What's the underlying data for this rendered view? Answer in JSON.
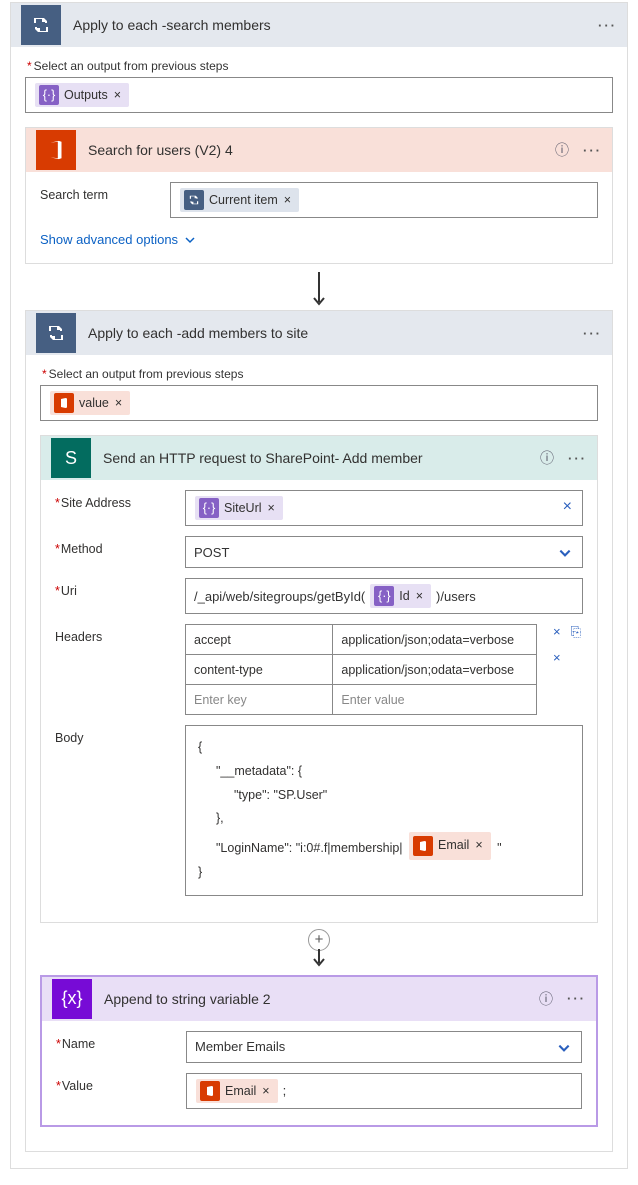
{
  "foreach1": {
    "title": "Apply to each -search members",
    "select_label": "Select an output from previous steps",
    "pill": "Outputs"
  },
  "o365search": {
    "title": "Search for users (V2) 4",
    "field_label": "Search term",
    "pill": "Current item",
    "advanced": "Show advanced options"
  },
  "foreach2": {
    "title": "Apply to each -add members to site",
    "select_label": "Select an output from previous steps",
    "pill": "value"
  },
  "sphttp": {
    "title": "Send an HTTP request to SharePoint- Add member",
    "fields": {
      "site_label": "Site Address",
      "site_pill": "SiteUrl",
      "method_label": "Method",
      "method_value": "POST",
      "uri_label": "Uri",
      "uri_prefix": "/_api/web/sitegroups/getById(",
      "uri_pill": "Id",
      "uri_suffix": ")/users",
      "headers_label": "Headers",
      "headers": [
        {
          "k": "accept",
          "v": "application/json;odata=verbose"
        },
        {
          "k": "content-type",
          "v": "application/json;odata=verbose"
        }
      ],
      "headers_key_ph": "Enter key",
      "headers_val_ph": "Enter value",
      "body_label": "Body",
      "body_lines": {
        "l1": "{",
        "l2": "\"__metadata\": {",
        "l3": "\"type\": \"SP.User\"",
        "l4": "},",
        "l5": "\"LoginName\": \"i:0#.f|membership|",
        "l5_pill": "Email",
        "l5_end": "\"",
        "l6": "}"
      }
    }
  },
  "appendvar": {
    "title": "Append to string variable 2",
    "name_label": "Name",
    "name_value": "Member Emails",
    "value_label": "Value",
    "value_pill": "Email",
    "value_suffix": ";"
  }
}
